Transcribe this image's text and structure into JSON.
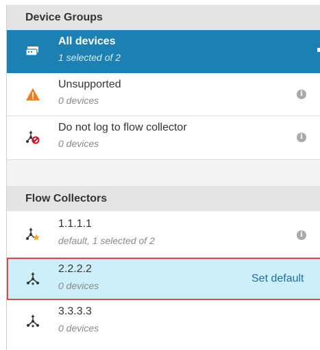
{
  "device_groups": {
    "title": "Device Groups",
    "items": [
      {
        "name": "All devices",
        "sub": "1 selected of 2",
        "icon": "device-stack-icon"
      },
      {
        "name": "Unsupported",
        "sub": "0 devices",
        "icon": "warning-triangle-icon"
      },
      {
        "name": "Do not log to flow collector",
        "sub": "0 devices",
        "icon": "no-log-flow-icon"
      }
    ]
  },
  "flow_collectors": {
    "title": "Flow Collectors",
    "items": [
      {
        "name": "1.1.1.1",
        "sub": "default, 1 selected of 2",
        "icon": "flow-collector-default-icon"
      },
      {
        "name": "2.2.2.2",
        "sub": "0 devices",
        "icon": "flow-collector-icon",
        "action": "Set default"
      },
      {
        "name": "3.3.3.3",
        "sub": "0 devices",
        "icon": "flow-collector-icon"
      }
    ]
  },
  "info_glyph": "i",
  "colors": {
    "selected_bg": "#1d80b3",
    "hover_bg": "#cdeefb",
    "highlight_border": "#e04848",
    "warning": "#f47c20",
    "no_log": "#e0001a"
  }
}
